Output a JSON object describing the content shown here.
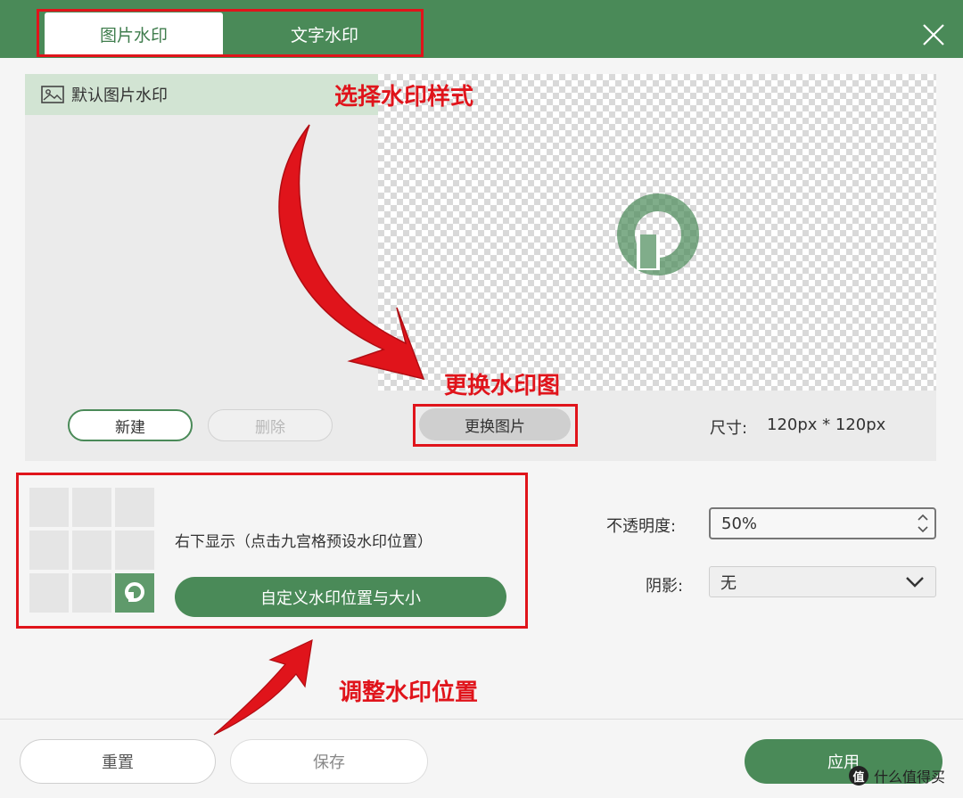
{
  "header": {
    "tabs": [
      {
        "label": "图片水印",
        "active": true
      },
      {
        "label": "文字水印",
        "active": false
      }
    ],
    "close_icon": "close-icon"
  },
  "watermark_list": {
    "items": [
      {
        "label": "默认图片水印",
        "icon": "image-icon"
      }
    ],
    "new_label": "新建",
    "delete_label": "删除"
  },
  "preview": {
    "change_image_label": "更换图片",
    "size_label": "尺寸:",
    "size_value": "120px * 120px"
  },
  "position": {
    "description": "右下显示（点击九宫格预设水印位置）",
    "custom_label": "自定义水印位置与大小",
    "selected_cell": "bottom-right"
  },
  "settings": {
    "opacity_label": "不透明度:",
    "opacity_value": "50%",
    "shadow_label": "阴影:",
    "shadow_value": "无"
  },
  "footer": {
    "reset_label": "重置",
    "save_label": "保存",
    "apply_label": "应用"
  },
  "annotations": {
    "select_style": "选择水印样式",
    "change_image": "更换水印图",
    "adjust_position": "调整水印位置"
  },
  "corner_watermark": {
    "text": "什么值得买",
    "icon_glyph": "值"
  },
  "colors": {
    "brand_green": "#4a8a58",
    "annotation_red": "#e0141b"
  }
}
